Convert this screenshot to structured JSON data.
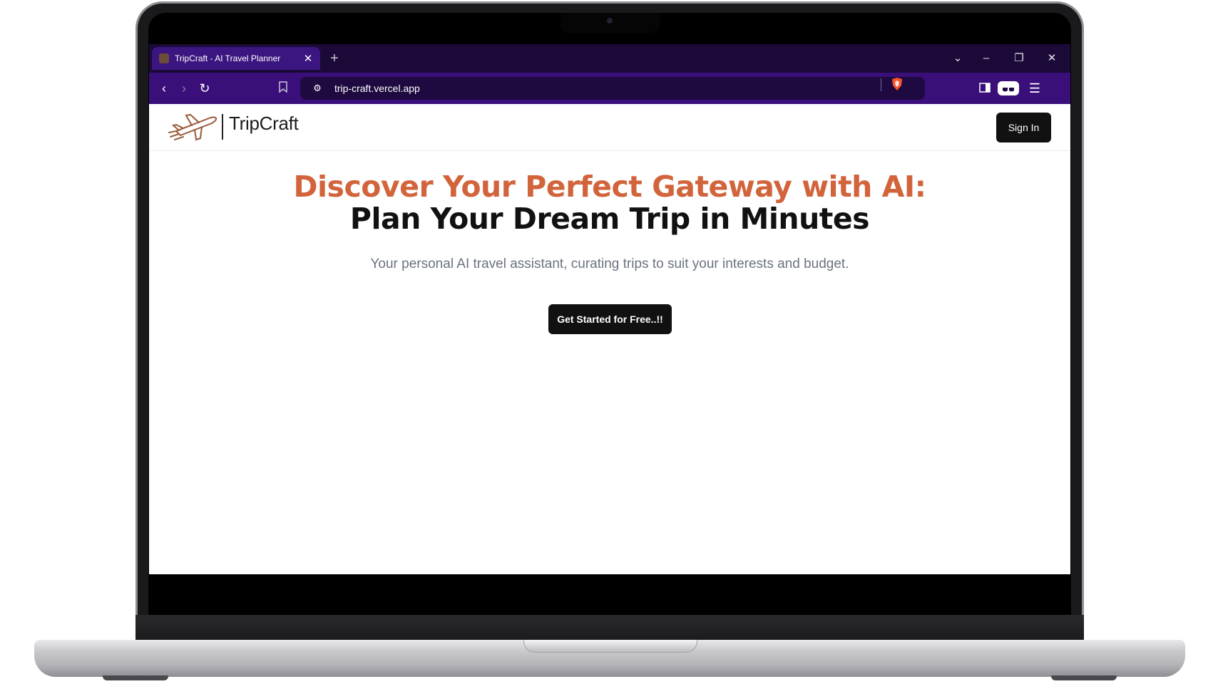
{
  "browser": {
    "tab_title": "TripCraft - AI Travel Planner",
    "url": "trip-craft.vercel.app"
  },
  "site": {
    "brand": "TripCraft",
    "sign_in_label": "Sign In",
    "headline_accent": "Discover Your Perfect Gateway with AI:",
    "headline_main": "Plan Your Dream Trip in Minutes",
    "subheadline": "Your personal AI travel assistant, curating trips to suit your interests and budget.",
    "cta_label": "Get Started for Free..!!"
  },
  "colors": {
    "accent": "#d2643c",
    "browser_toolbar": "#3a0f7a",
    "browser_tabstrip": "#1b0a38",
    "button_dark": "#111111"
  },
  "icons": {
    "toolbar": [
      "back-icon",
      "forward-icon",
      "reload-icon",
      "bookmark-icon",
      "site-settings-icon",
      "brave-shield-icon",
      "sidebar-icon",
      "wallet-icon",
      "menu-icon"
    ],
    "window": [
      "tab-list-icon",
      "minimize-icon",
      "restore-icon",
      "close-icon"
    ]
  }
}
